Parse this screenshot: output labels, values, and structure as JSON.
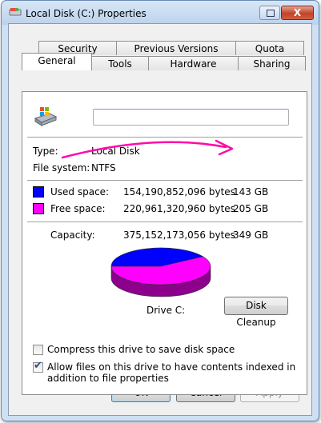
{
  "window": {
    "title": "Local Disk (C:) Properties",
    "close_glyph": "X"
  },
  "tabs_row_back": [
    "Security",
    "Previous Versions",
    "Quota"
  ],
  "tabs_row_front": [
    "General",
    "Tools",
    "Hardware",
    "Sharing"
  ],
  "active_tab": "General",
  "general": {
    "name_value": "",
    "type_label": "Type:",
    "type_value": "Local Disk",
    "fs_label": "File system:",
    "fs_value": "NTFS",
    "used": {
      "label": "Used space:",
      "bytes": "154,190,852,096 bytes",
      "size": "143 GB",
      "color": "#0000ff",
      "fraction": 0.411
    },
    "free": {
      "label": "Free space:",
      "bytes": "220,961,320,960 bytes",
      "size": "205 GB",
      "color": "#ff00ff",
      "fraction": 0.589
    },
    "capacity": {
      "label": "Capacity:",
      "bytes": "375,152,173,056 bytes",
      "size": "349 GB"
    },
    "drive_label": "Drive C:",
    "disk_cleanup": "Disk Cleanup",
    "compress": {
      "label": "Compress this drive to save disk space",
      "checked": false
    },
    "index": {
      "label": "Allow files on this drive to have contents indexed in addition to file properties",
      "checked": true
    }
  },
  "buttons": {
    "ok": "OK",
    "cancel": "Cancel",
    "apply": "Apply"
  },
  "annotation_color": "#ff0aa8"
}
